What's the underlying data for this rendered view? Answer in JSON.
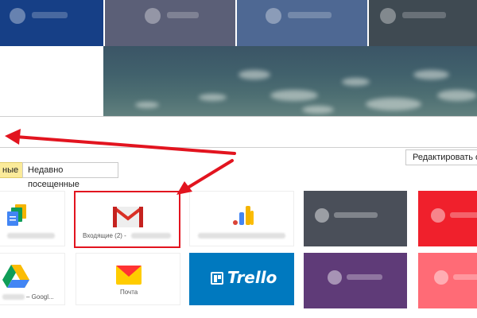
{
  "tabs": {
    "favorites_label": "ные",
    "recent_label": "Недавно посещенные"
  },
  "toolbar": {
    "edit_label": "Редактировать оп"
  },
  "tiles": {
    "gmail_label": "Входящие (2) -",
    "drive_label": "– Googl...",
    "mail_label": "Почта",
    "trello_label": "Trello"
  },
  "icons": {
    "gmail": "gmail-icon",
    "docs": "google-docs-icon",
    "drive": "google-drive-icon",
    "mail": "yandex-mail-icon",
    "trello": "trello-icon",
    "analytics": "analytics-icon"
  },
  "colors": {
    "highlight": "#e2141f",
    "trello": "#0079bf",
    "active_tab": "#fbeb9a"
  }
}
